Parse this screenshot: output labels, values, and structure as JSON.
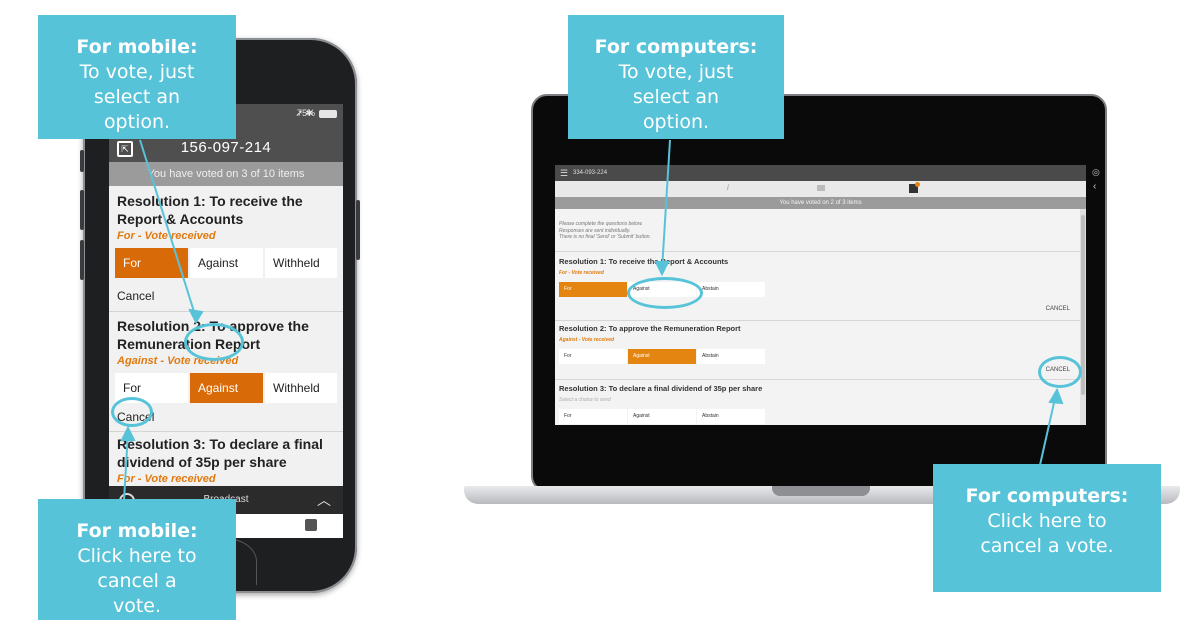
{
  "callouts": {
    "mobile_select": {
      "heading": "For mobile:",
      "body": "To vote, just select an option."
    },
    "mobile_cancel": {
      "heading": "For mobile:",
      "body": "Click here to cancel a vote."
    },
    "computer_select": {
      "heading": "For computers:",
      "body": "To vote, just select an option."
    },
    "computer_cancel": {
      "heading": "For computers:",
      "body": "Click here to cancel a vote."
    }
  },
  "phone": {
    "status_battery": "75%",
    "meeting_id": "156-097-214",
    "voted_banner": "You have voted on 3 of 10 items",
    "broadcast_label": "Broadcast",
    "resolutions": [
      {
        "title": "Resolution 1: To receive the Report & Accounts",
        "status": "For - Vote received",
        "options": [
          "For",
          "Against",
          "Withheld"
        ],
        "selected": "For",
        "cancel": "Cancel"
      },
      {
        "title": "Resolution 2: To approve the Remuneration Report",
        "status": "Against - Vote received",
        "options": [
          "For",
          "Against",
          "Withheld"
        ],
        "selected": "Against",
        "cancel": "Cancel"
      },
      {
        "title": "Resolution 3: To declare a final dividend of 35p per share",
        "status": "For - Vote received"
      }
    ]
  },
  "laptop": {
    "meeting_id": "334-093-224",
    "voted_banner": "You have voted on 2 of 3 items",
    "intro": [
      "Please complete the questions below.",
      "Responses are sent individually.",
      "There is no final 'Send' or 'Submit' button."
    ],
    "resolutions": [
      {
        "title": "Resolution 1: To receive the Report & Accounts",
        "status": "For - Vote received",
        "options": [
          "For",
          "Against",
          "Abstain"
        ],
        "selected": "For",
        "cancel": "CANCEL"
      },
      {
        "title": "Resolution 2: To approve the Remuneration Report",
        "status": "Against - Vote received",
        "options": [
          "For",
          "Against",
          "Abstain"
        ],
        "selected": "Against",
        "cancel": "CANCEL"
      },
      {
        "title": "Resolution 3: To declare a final dividend of 35p per share",
        "status": "Select a choice to send",
        "options": [
          "For",
          "Against",
          "Abstain"
        ]
      }
    ]
  },
  "colors": {
    "accent": "#57c3d8",
    "selected": "#d96a08",
    "header": "#4f4f4f"
  }
}
